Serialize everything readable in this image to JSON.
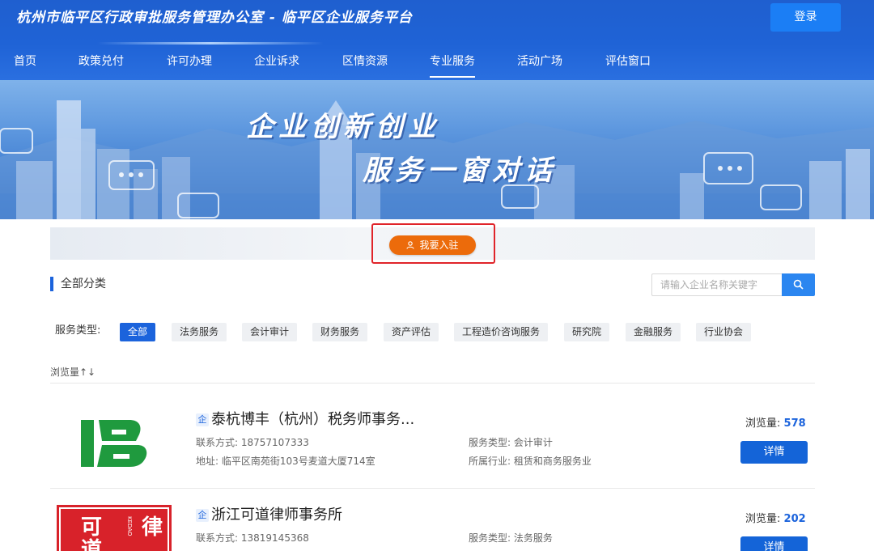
{
  "header": {
    "site_title": "杭州市临平区行政审批服务管理办公室 - 临平区企业服务平台",
    "login_label": "登录"
  },
  "nav": {
    "items": [
      {
        "label": "首页"
      },
      {
        "label": "政策兑付"
      },
      {
        "label": "许可办理"
      },
      {
        "label": "企业诉求"
      },
      {
        "label": "区情资源"
      },
      {
        "label": "专业服务",
        "active": true
      },
      {
        "label": "活动广场"
      },
      {
        "label": "评估窗口"
      }
    ]
  },
  "banner": {
    "line1": "企业创新创业",
    "line2": "服务一窗对话"
  },
  "join": {
    "label": "我要入驻",
    "icon": "user-icon"
  },
  "category": {
    "title": "全部分类",
    "search_placeholder": "请输入企业名称关键字",
    "search_value": ""
  },
  "filter": {
    "label": "服务类型:",
    "options": [
      "全部",
      "法务服务",
      "会计审计",
      "财务服务",
      "资产评估",
      "工程造价咨询服务",
      "研究院",
      "金融服务",
      "行业协会"
    ],
    "selected": "全部"
  },
  "sort": {
    "label": "浏览量↑↓"
  },
  "companies": [
    {
      "badge": "企",
      "name": "泰杭博丰（杭州）税务师事务...",
      "contact_label": "联系方式:",
      "contact": "18757107333",
      "address_label": "地址:",
      "address": "临平区南苑街103号麦道大厦714室",
      "service_type_label": "服务类型:",
      "service_type": "会计审计",
      "industry_label": "所属行业:",
      "industry": "租赁和商务服务业",
      "views_label": "浏览量:",
      "views": "578",
      "detail_label": "详情",
      "logo_color": "#1f9a3e"
    },
    {
      "badge": "企",
      "name": "浙江可道律师事务所",
      "contact_label": "联系方式:",
      "contact": "13819145368",
      "service_type_label": "服务类型:",
      "service_type": "法务服务",
      "views_label": "浏览量:",
      "views": "202",
      "detail_label": "详情",
      "logo_color": "#d8222a",
      "logo_text": "可道律",
      "logo_vertical_text": "KEDAO"
    }
  ],
  "colors": {
    "primary": "#1b63dc",
    "header_bg": "#1f5fcf",
    "join_orange": "#ec6b0b",
    "highlight_red": "#e0242a"
  }
}
